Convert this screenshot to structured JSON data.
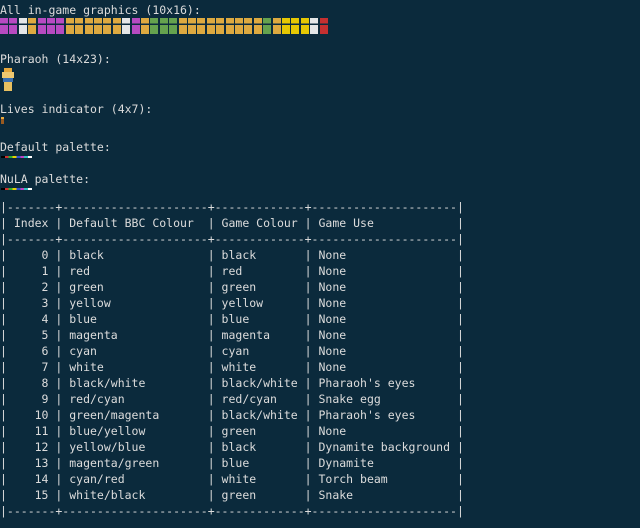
{
  "labels": {
    "all_graphics": "All in-game graphics (10x16):",
    "pharaoh": "Pharaoh (14x23):",
    "lives": "Lives indicator (4x7):",
    "default_palette": "Default palette:",
    "nula_palette": "NuLA palette:"
  },
  "colors": {
    "background": "#0b2a3c",
    "text": "#dcdcdc",
    "sprite_magenta": "#c04cc8",
    "sprite_gold": "#e8b040",
    "sprite_green": "#6aa84f",
    "sprite_white": "#f0f0f0",
    "sprite_red": "#d03030",
    "sprite_yellow": "#f2d000"
  },
  "table": {
    "border_top": "|-------+---------------------+-------------+---------------------|",
    "border_sep": "|-------+---------------------+-------------+---------------------|",
    "border_bottom": "|-------+---------------------+-------------+---------------------|",
    "headers": [
      "Index",
      "Default BBC Colour",
      "Game Colour",
      "Game Use"
    ],
    "rows": [
      [
        "0",
        "black",
        "black",
        "None"
      ],
      [
        "1",
        "red",
        "red",
        "None"
      ],
      [
        "2",
        "green",
        "green",
        "None"
      ],
      [
        "3",
        "yellow",
        "yellow",
        "None"
      ],
      [
        "4",
        "blue",
        "blue",
        "None"
      ],
      [
        "5",
        "magenta",
        "magenta",
        "None"
      ],
      [
        "6",
        "cyan",
        "cyan",
        "None"
      ],
      [
        "7",
        "white",
        "white",
        "None"
      ],
      [
        "8",
        "black/white",
        "black/white",
        "Pharaoh's eyes"
      ],
      [
        "9",
        "red/cyan",
        "red/cyan",
        "Snake egg"
      ],
      [
        "10",
        "green/magenta",
        "black/white",
        "Pharaoh's eyes"
      ],
      [
        "11",
        "blue/yellow",
        "green",
        "None"
      ],
      [
        "12",
        "yellow/blue",
        "black",
        "Dynamite background"
      ],
      [
        "13",
        "magenta/green",
        "blue",
        "Dynamite"
      ],
      [
        "14",
        "cyan/red",
        "white",
        "Torch beam"
      ],
      [
        "15",
        "white/black",
        "green",
        "Snake"
      ]
    ]
  }
}
